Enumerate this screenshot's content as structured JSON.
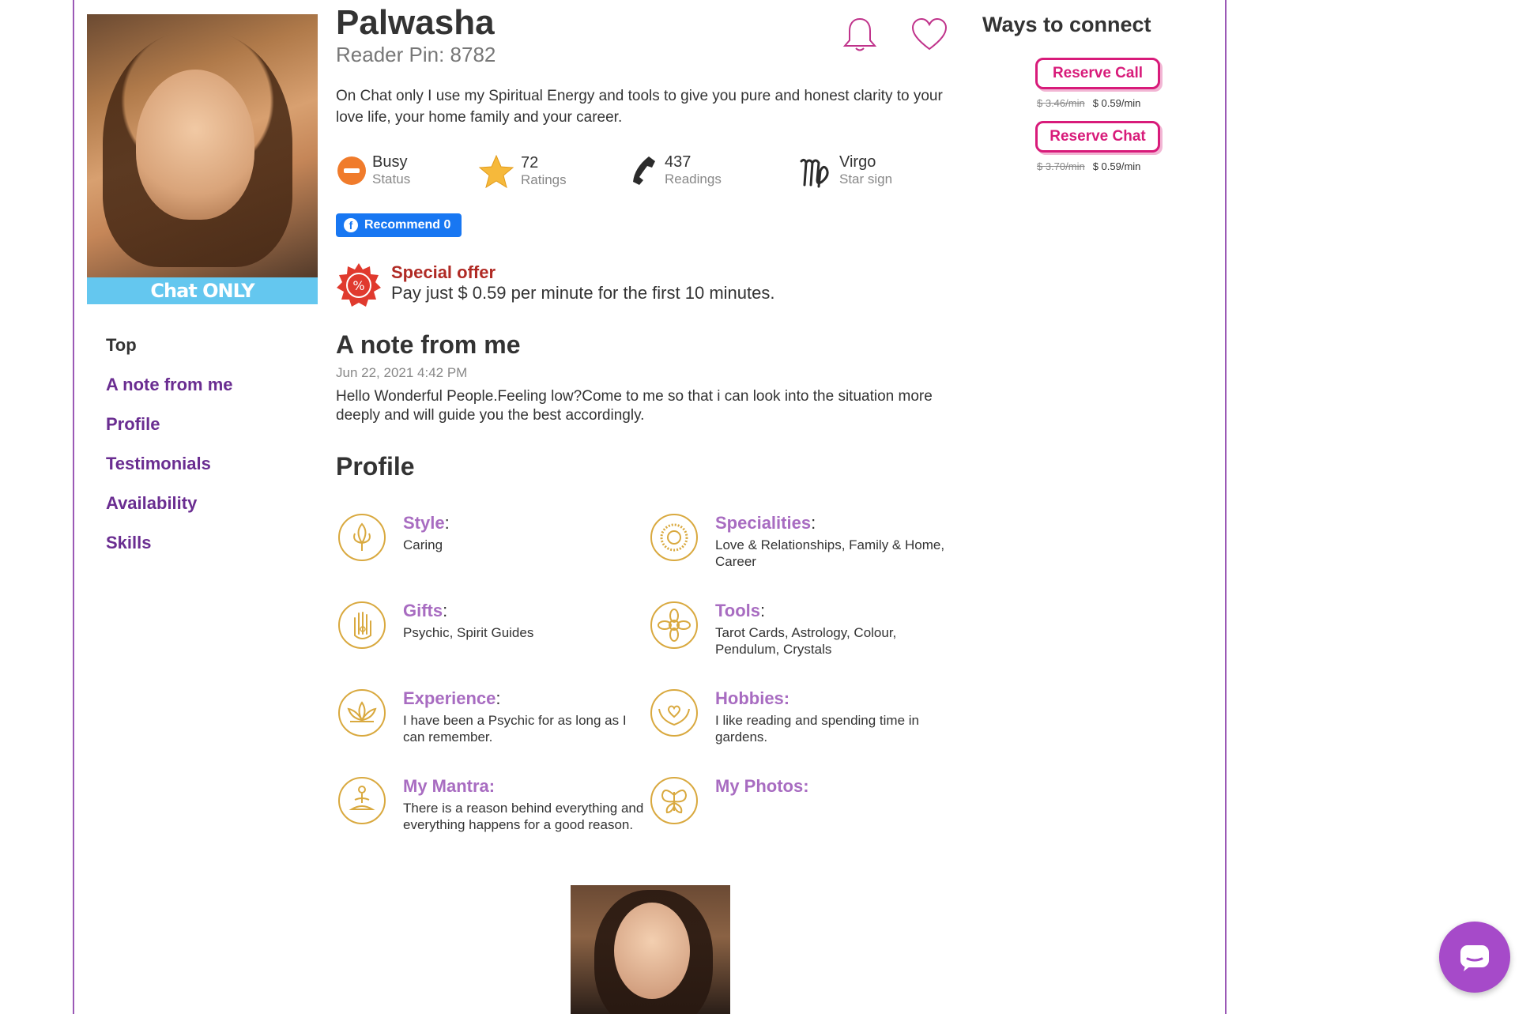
{
  "reader": {
    "name": "Palwasha",
    "pin": "Reader Pin: 8782",
    "avatar_badge": "Chat ONLY",
    "intro": "On Chat only I use my Spiritual Energy and tools to give you pure and honest clarity to your love life, your home family and your career."
  },
  "stats": [
    {
      "value": "Busy",
      "label": "Status",
      "icon": "busy-icon"
    },
    {
      "value": "72",
      "label": "Ratings",
      "icon": "star-icon"
    },
    {
      "value": "437",
      "label": "Readings",
      "icon": "phone-icon"
    },
    {
      "value": "Virgo",
      "label": "Star sign",
      "icon": "virgo-icon"
    }
  ],
  "facebook": {
    "label": "Recommend 0"
  },
  "offer": {
    "title": "Special offer",
    "text": "Pay just $ 0.59 per minute for the first 10 minutes."
  },
  "note": {
    "heading": "A note from me",
    "date": "Jun 22, 2021 4:42 PM",
    "text": "Hello Wonderful People.Feeling low?Come to me so that i can look into the situation more deeply and will guide you the best accordingly."
  },
  "profile": {
    "heading": "Profile",
    "items": [
      {
        "title": "Style",
        "colon": ":",
        "value": "Caring",
        "icon": "lotus-bud-icon"
      },
      {
        "title": "Specialities",
        "colon": ":",
        "value": "Love & Relationships, Family & Home, Career",
        "icon": "sun-mandala-icon"
      },
      {
        "title": "Gifts",
        "colon": ":",
        "value": "Psychic, Spirit Guides",
        "icon": "hamsa-hand-icon"
      },
      {
        "title": "Tools",
        "colon": ":",
        "value": "Tarot Cards, Astrology, Colour, Pendulum, Crystals",
        "icon": "flower-mandala-icon"
      },
      {
        "title": "Experience",
        "colon": ":",
        "value": "I have been a Psychic for as long as I can remember.",
        "icon": "lotus-icon"
      },
      {
        "title": "Hobbies:",
        "colon": "",
        "value": "I like reading and spending time in gardens.",
        "icon": "hands-heart-icon"
      },
      {
        "title": "My Mantra:",
        "colon": "",
        "value": "There is a reason behind everything and everything happens for a good reason.",
        "icon": "meditation-icon"
      },
      {
        "title": "My Photos:",
        "colon": "",
        "value": "",
        "icon": "butterfly-icon"
      }
    ]
  },
  "nav": {
    "items": [
      "Top",
      "A note from me",
      "Profile",
      "Testimonials",
      "Availability",
      "Skills"
    ]
  },
  "connect": {
    "heading": "Ways to connect",
    "call": {
      "label": "Reserve Call",
      "old_price": "$ 3.46/min",
      "price": "$ 0.59/min"
    },
    "chat": {
      "label": "Reserve Chat",
      "old_price": "$ 3.70/min",
      "price": "$ 0.59/min"
    }
  },
  "colors": {
    "accent": "#6a2d91",
    "pink": "#d81b7a",
    "gold": "#d9a93f",
    "title_purple": "#a86cc1"
  }
}
